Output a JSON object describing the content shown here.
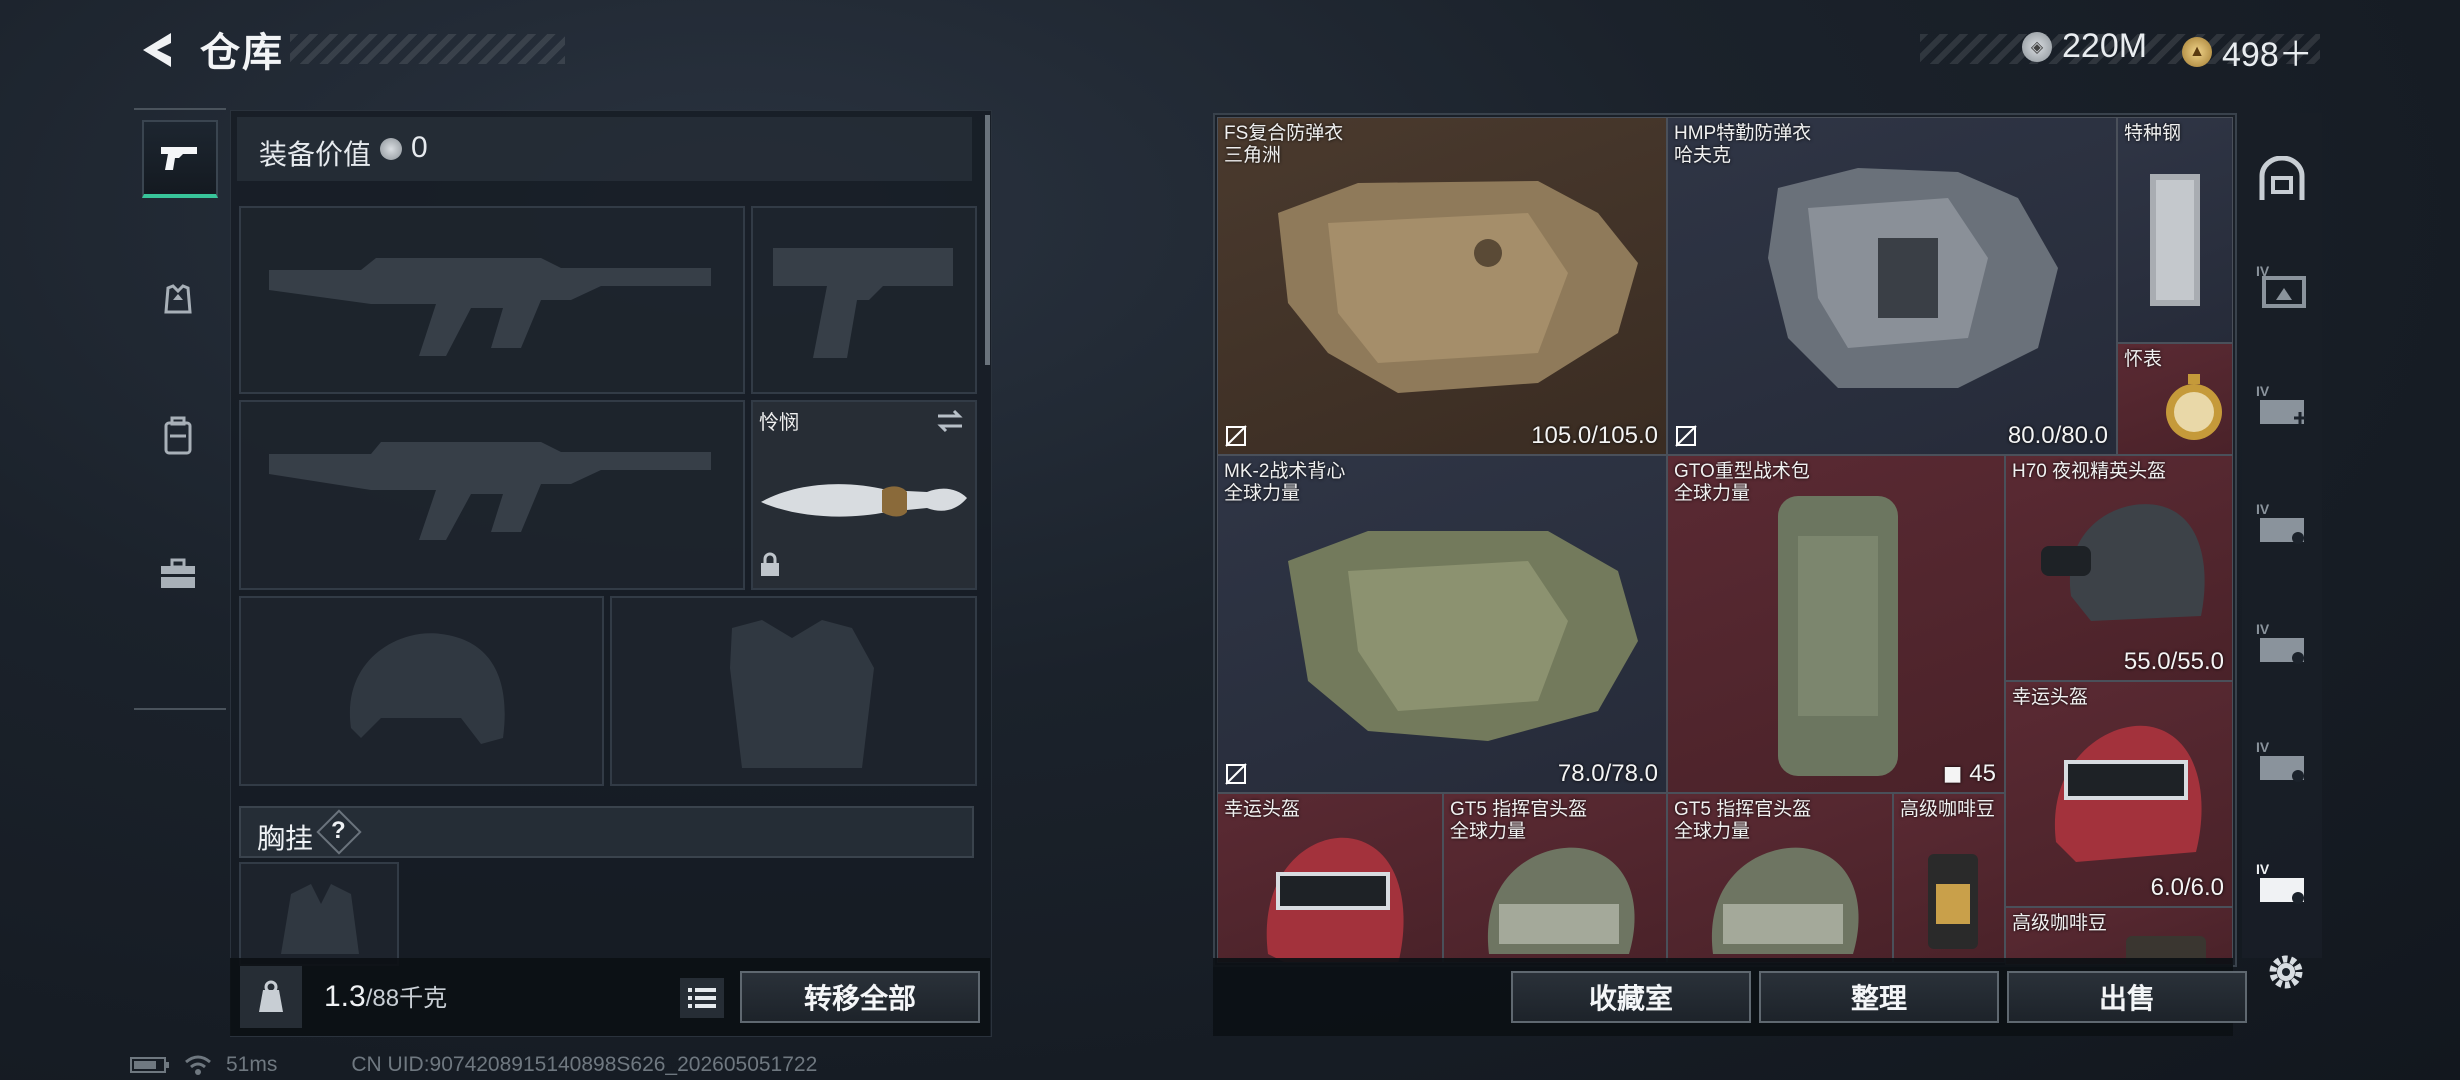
{
  "header": {
    "title": "仓库"
  },
  "currency": [
    {
      "icon": "silver-coin-icon",
      "value": "220M",
      "color": "#b8bec4"
    },
    {
      "icon": "gold-coin-icon",
      "value": "498＋",
      "color": "#c9a65a"
    }
  ],
  "left_sidebar": {
    "tabs": [
      {
        "icon": "pistol-icon",
        "active": true
      },
      {
        "icon": "armor-vest-icon",
        "active": false
      },
      {
        "icon": "backpack-icon",
        "active": false
      },
      {
        "icon": "toolbox-icon",
        "active": false
      }
    ]
  },
  "loadout": {
    "equip_value_label": "装备价值",
    "equip_value": "0",
    "melee_name": "怜悯",
    "chest_rig_label": "胸挂",
    "help_label": "?",
    "weight_current": "1.3",
    "weight_max": "/88千克",
    "transfer_all_label": "转移全部"
  },
  "inventory": {
    "items": [
      {
        "name": "FS复合防弹衣",
        "sub": "三角洲",
        "durability": "105.0/105.0",
        "rarity": "#4a3a2e"
      },
      {
        "name": "HMP特勤防弹衣",
        "sub": "哈夫克",
        "durability": "80.0/80.0",
        "rarity": "#2f3545"
      },
      {
        "name": "特种钢",
        "sub": "",
        "durability": "",
        "rarity": "#2f3545"
      },
      {
        "name": "怀表",
        "sub": "",
        "durability": "",
        "rarity": "#5a2a33"
      },
      {
        "name": "MK-2战术背心",
        "sub": "全球力量",
        "durability": "78.0/78.0",
        "rarity": "#2f3545"
      },
      {
        "name": "GTO重型战术包",
        "sub": "全球力量",
        "durability": "",
        "count": "45",
        "rarity": "#5a2a33"
      },
      {
        "name": "H70 夜视精英头盔",
        "sub": "",
        "durability": "55.0/55.0",
        "rarity": "#5a2a33"
      },
      {
        "name": "幸运头盔",
        "sub": "",
        "durability": "6.0/6.0",
        "rarity": "#5a2a33"
      },
      {
        "name": "幸运头盔",
        "sub": "",
        "durability": "",
        "rarity": "#5a2a33"
      },
      {
        "name": "GT5 指挥官头盔",
        "sub": "全球力量",
        "durability": "",
        "rarity": "#5a2a33"
      },
      {
        "name": "GT5 指挥官头盔",
        "sub": "全球力量",
        "durability": "",
        "rarity": "#5a2a33"
      },
      {
        "name": "高级咖啡豆",
        "sub": "",
        "durability": "",
        "rarity": "#5a2a33"
      },
      {
        "name": "高级咖啡豆",
        "sub": "",
        "durability": "",
        "rarity": "#5a2a33"
      }
    ]
  },
  "right_sidebar": {
    "tabs": [
      {
        "icon": "safe-box-icon"
      },
      {
        "icon": "storage-tab-iv-1-icon",
        "label": "IV"
      },
      {
        "icon": "storage-tab-iv-2-icon",
        "label": "IV"
      },
      {
        "icon": "storage-tab-iv-3-icon",
        "label": "IV"
      },
      {
        "icon": "storage-tab-iv-4-icon",
        "label": "IV"
      },
      {
        "icon": "storage-tab-iv-5-icon",
        "label": "IV"
      },
      {
        "icon": "storage-tab-iv-6-icon",
        "label": "IV"
      }
    ],
    "settings_icon": "gear-icon"
  },
  "bottom_buttons": {
    "collection_label": "收藏室",
    "organize_label": "整理",
    "sell_label": "出售"
  },
  "status": {
    "ping": "51ms",
    "uid": "CN UID:9074208915140898S626_202605051722"
  }
}
